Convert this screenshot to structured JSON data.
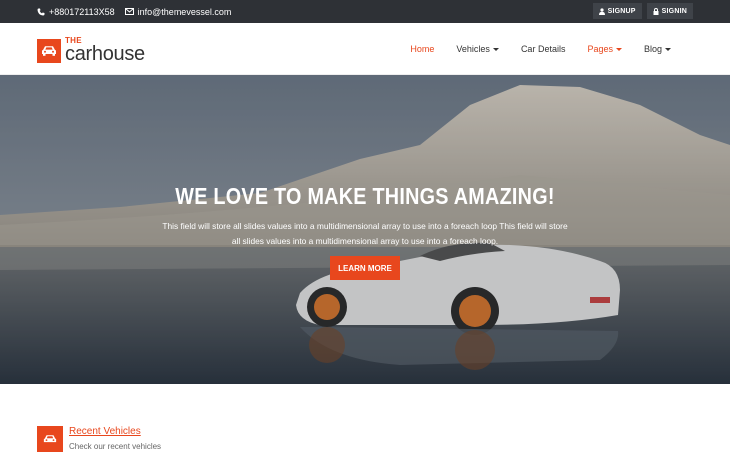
{
  "topbar": {
    "phone": "+880172113X58",
    "email": "info@themevessel.com",
    "signup_label": "SIGNUP",
    "signin_label": "SIGNIN"
  },
  "logo": {
    "the": "THE",
    "name": "carhouse"
  },
  "nav": {
    "items": [
      {
        "label": "Home"
      },
      {
        "label": "Vehicles"
      },
      {
        "label": "Car Details"
      },
      {
        "label": "Pages"
      },
      {
        "label": "Blog"
      }
    ]
  },
  "hero": {
    "title": "WE LOVE TO MAKE THINGS AMAZING!",
    "text": "This field will store all slides values into a multidimensional array to use into a foreach loop This field will store all slides values into a multidimensional array to use into a foreach loop.",
    "button_label": "LEARN MORE"
  },
  "recent": {
    "title": "Recent Vehicles",
    "subtitle": "Check our recent vehicles"
  },
  "colors": {
    "accent": "#e8471d",
    "topbar": "#2e3136"
  }
}
